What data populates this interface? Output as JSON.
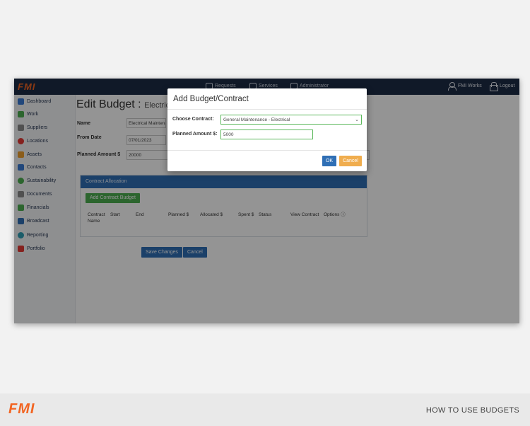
{
  "app": {
    "logo": "FMI",
    "topnav": [
      {
        "label": "Requests",
        "icon": "requests-icon"
      },
      {
        "label": "Services",
        "icon": "services-icon"
      },
      {
        "label": "Administrator",
        "icon": "administrator-icon"
      }
    ],
    "user_label": "FMI Works",
    "logout_label": "Logout"
  },
  "sidebar": {
    "items": [
      {
        "label": "Dashboard",
        "icon": "dashboard-icon",
        "color": "#3a7bd5"
      },
      {
        "label": "Work",
        "icon": "check-icon",
        "color": "#4caf50"
      },
      {
        "label": "Suppliers",
        "icon": "wrench-icon",
        "color": "#8a8a8a"
      },
      {
        "label": "Locations",
        "icon": "map-pin-icon",
        "color": "#e53935"
      },
      {
        "label": "Assets",
        "icon": "assets-icon",
        "color": "#f0a030"
      },
      {
        "label": "Contacts",
        "icon": "contacts-icon",
        "color": "#3a7bd5"
      },
      {
        "label": "Sustainability",
        "icon": "sustainability-icon",
        "color": "#4caf50"
      },
      {
        "label": "Documents",
        "icon": "paperclip-icon",
        "color": "#8a8a8a"
      },
      {
        "label": "Financials",
        "icon": "dollar-icon",
        "color": "#4caf50"
      },
      {
        "label": "Broadcast",
        "icon": "megaphone-icon",
        "color": "#2f6fb5"
      },
      {
        "label": "Reporting",
        "icon": "reporting-icon",
        "color": "#2f9fb5"
      },
      {
        "label": "Portfolio",
        "icon": "briefcase-icon",
        "color": "#e53935"
      }
    ]
  },
  "page": {
    "title": "Edit Budget :",
    "title_suffix": "Electric",
    "name_label": "Name",
    "name_value": "Electrical Maintenance",
    "from_date_label": "From Date",
    "from_date_value": "07/01/2023",
    "planned_label": "Planned Amount $",
    "planned_value": "20000"
  },
  "allocation": {
    "header": "Contract Allocation",
    "add_button": "Add Contract Budget",
    "columns": [
      "Contract Name",
      "Start",
      "End",
      "Planned $",
      "Allocated $",
      "Spent $",
      "Status",
      "View Contract",
      "Options ⓘ"
    ]
  },
  "actions": {
    "save": "Save Changes",
    "cancel": "Cancel"
  },
  "modal": {
    "title": "Add Budget/Contract",
    "contract_label": "Choose Contract:",
    "contract_value": "General Maintenance - Electrical",
    "amount_label": "Planned Amount $:",
    "amount_value": "5000",
    "ok": "OK",
    "cancel": "Cancel"
  },
  "footer": {
    "logo": "FMI",
    "text": "HOW TO USE BUDGETS"
  },
  "colors": {
    "brand": "#f26522",
    "topbar": "#1d2b45",
    "primary": "#2f6fb5",
    "success": "#4caf50",
    "warning": "#f0ad4e"
  }
}
